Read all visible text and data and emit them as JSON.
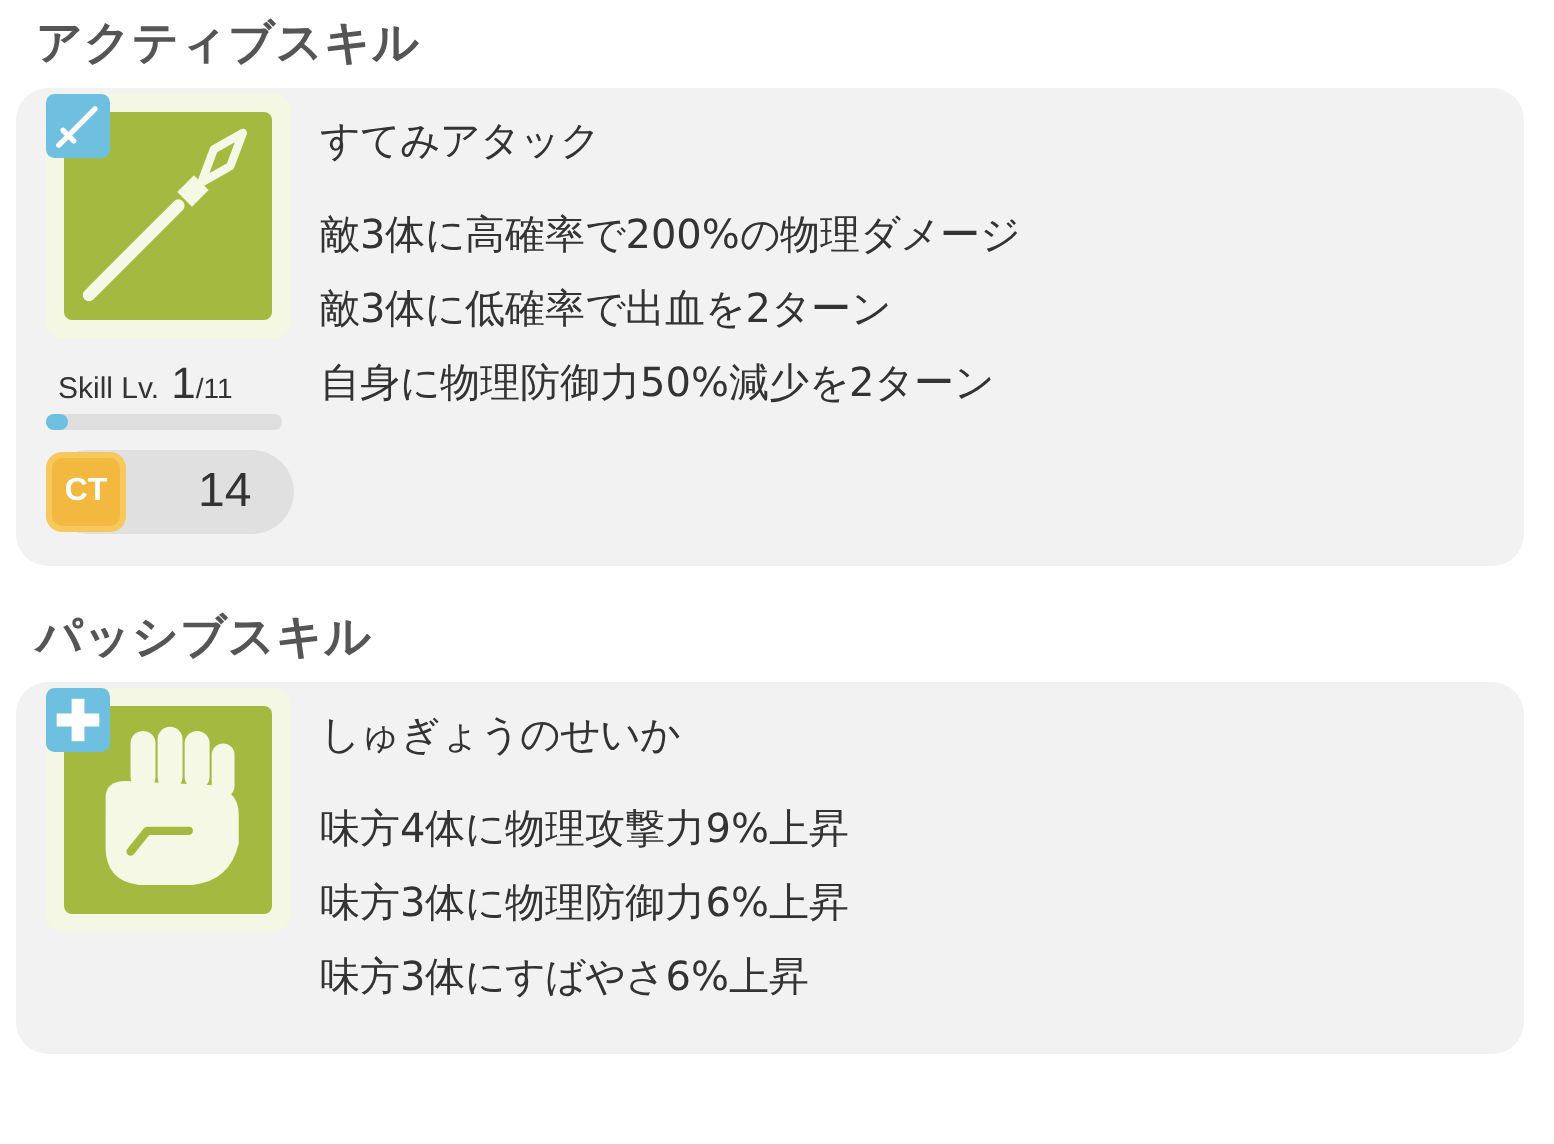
{
  "sections": [
    {
      "title": "アクティブスキル",
      "skill": {
        "kind": "active",
        "name": "すてみアタック",
        "effects": [
          "敵3体に高確率で200%の物理ダメージ",
          "敵3体に低確率で出血を2ターン",
          "自身に物理防御力50%減少を2ターン"
        ],
        "level_label": "Skill Lv.",
        "level_value": "1",
        "level_max": "/11",
        "level": 0.09,
        "ct_label": "CT",
        "ct_value": "14"
      }
    },
    {
      "title": "パッシブスキル",
      "skill": {
        "kind": "passive",
        "name": "しゅぎょうのせいか",
        "effects": [
          "味方4体に物理攻撃力9%上昇",
          "味方3体に物理防御力6%上昇",
          "味方3体にすばやさ6%上昇"
        ]
      }
    }
  ]
}
